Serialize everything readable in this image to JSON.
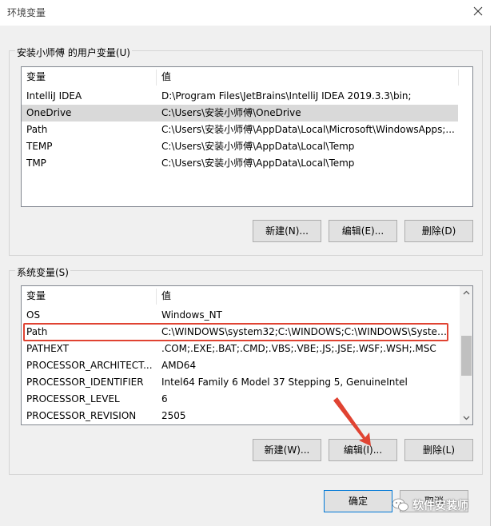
{
  "window": {
    "title": "环境变量"
  },
  "user_vars": {
    "group_label": "安装小师傅 的用户变量(U)",
    "columns": [
      "变量",
      "值"
    ],
    "rows": [
      {
        "name": "IntelliJ IDEA",
        "value": "D:\\Program Files\\JetBrains\\IntelliJ IDEA 2019.3.3\\bin;"
      },
      {
        "name": "OneDrive",
        "value": "C:\\Users\\安装小师傅\\OneDrive"
      },
      {
        "name": "Path",
        "value": "C:\\Users\\安装小师傅\\AppData\\Local\\Microsoft\\WindowsApps;..."
      },
      {
        "name": "TEMP",
        "value": "C:\\Users\\安装小师傅\\AppData\\Local\\Temp"
      },
      {
        "name": "TMP",
        "value": "C:\\Users\\安装小师傅\\AppData\\Local\\Temp"
      }
    ],
    "selected_row": "OneDrive",
    "buttons": {
      "new": "新建(N)...",
      "edit": "编辑(E)...",
      "delete": "删除(D)"
    }
  },
  "system_vars": {
    "group_label": "系统变量(S)",
    "columns": [
      "变量",
      "值"
    ],
    "rows": [
      {
        "name": "OS",
        "value": "Windows_NT"
      },
      {
        "name": "Path",
        "value": "C:\\WINDOWS\\system32;C:\\WINDOWS;C:\\WINDOWS\\System..."
      },
      {
        "name": "PATHEXT",
        "value": ".COM;.EXE;.BAT;.CMD;.VBS;.VBE;.JS;.JSE;.WSF;.WSH;.MSC"
      },
      {
        "name": "PROCESSOR_ARCHITECT...",
        "value": "AMD64"
      },
      {
        "name": "PROCESSOR_IDENTIFIER",
        "value": "Intel64 Family 6 Model 37 Stepping 5, GenuineIntel"
      },
      {
        "name": "PROCESSOR_LEVEL",
        "value": "6"
      },
      {
        "name": "PROCESSOR_REVISION",
        "value": "2505"
      }
    ],
    "highlighted_row": "Path",
    "buttons": {
      "new": "新建(W)...",
      "edit": "编辑(I)...",
      "delete": "删除(L)"
    }
  },
  "footer": {
    "ok": "确定",
    "cancel": "取消"
  },
  "watermark": {
    "text": "软件安装师"
  },
  "colors": {
    "highlight": "#e04332",
    "arrow": "#e04332",
    "selection": "#d9d9d9",
    "focus_border": "#0078d7"
  }
}
